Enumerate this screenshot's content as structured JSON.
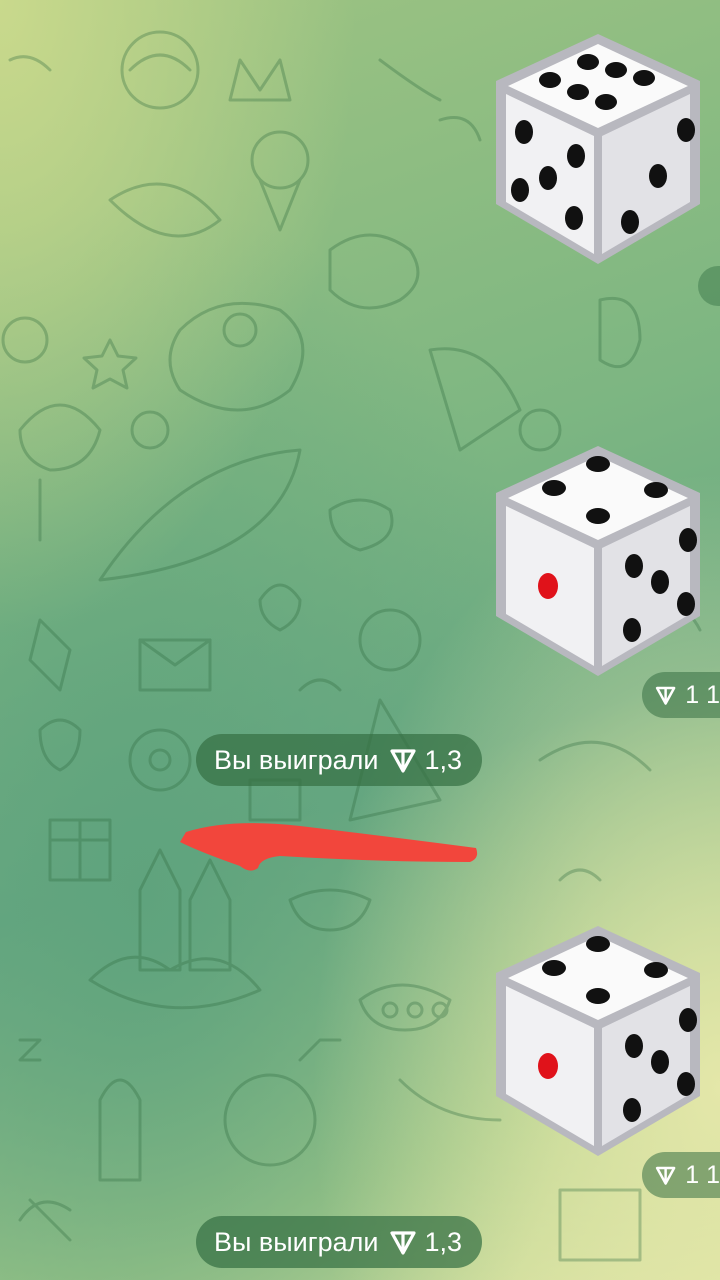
{
  "chat": {
    "messages": [
      {
        "type": "dice",
        "value": 6,
        "side_value": 5
      },
      {
        "type": "dice",
        "value": 5,
        "side_value": 1,
        "stake_label": "1 1"
      },
      {
        "type": "service",
        "text": "Вы выиграли",
        "amount": "1,3",
        "currency_icon": "ton-icon"
      },
      {
        "type": "dice",
        "value": 5,
        "side_value": 1,
        "stake_label": "1 1"
      },
      {
        "type": "service",
        "text": "Вы выиграли",
        "amount": "1,3",
        "currency_icon": "ton-icon"
      }
    ]
  },
  "colors": {
    "badge_bg": "#367044",
    "annotation_red": "#f2463c",
    "dice_pip": "#111111",
    "dice_red_pip": "#e0121a"
  }
}
